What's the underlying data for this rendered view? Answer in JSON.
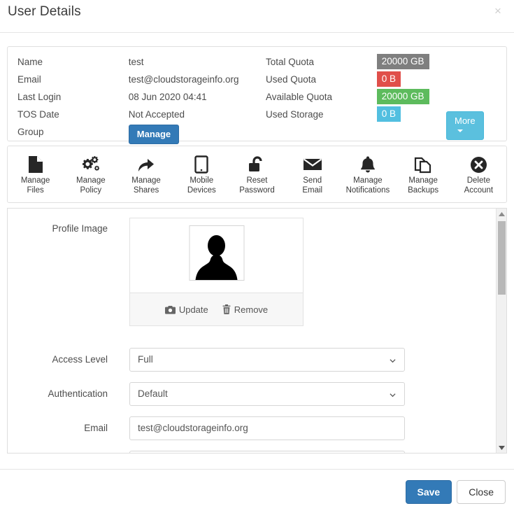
{
  "modal": {
    "title": "User Details",
    "close_icon": "close-icon",
    "close_label": "×"
  },
  "info": {
    "left_rows": [
      {
        "label": "Name",
        "value": "test"
      },
      {
        "label": "Email",
        "value": "test@cloudstorageinfo.org"
      },
      {
        "label": "Last Login",
        "value": "08 Jun 2020 04:41"
      },
      {
        "label": "TOS Date",
        "value": "Not Accepted"
      },
      {
        "label": "Group",
        "value": ""
      }
    ],
    "group_button": "Manage",
    "right_rows": [
      {
        "label": "Total Quota",
        "value": "20000 GB",
        "color": "gray"
      },
      {
        "label": "Used Quota",
        "value": "0 B",
        "color": "red"
      },
      {
        "label": "Available Quota",
        "value": "20000 GB",
        "color": "green"
      },
      {
        "label": "Used Storage",
        "value": "0 B",
        "color": "blue"
      }
    ],
    "more_button": "More",
    "colors": {
      "gray": "#7f7f7f",
      "red": "#e04f4a",
      "green": "#5dbb5d",
      "blue": "#52bfe0",
      "primary": "#337ab7"
    }
  },
  "toolbar": {
    "items": [
      {
        "icon": "file-icon",
        "line1": "Manage",
        "line2": "Files"
      },
      {
        "icon": "gears-icon",
        "line1": "Manage",
        "line2": "Policy"
      },
      {
        "icon": "share-arrow-icon",
        "line1": "Manage",
        "line2": "Shares"
      },
      {
        "icon": "tablet-icon",
        "line1": "Mobile",
        "line2": "Devices"
      },
      {
        "icon": "unlock-icon",
        "line1": "Reset",
        "line2": "Password"
      },
      {
        "icon": "envelope-icon",
        "line1": "Send",
        "line2": "Email"
      },
      {
        "icon": "bell-icon",
        "line1": "Manage",
        "line2": "Notifications"
      },
      {
        "icon": "copy-files-icon",
        "line1": "Manage",
        "line2": "Backups"
      },
      {
        "icon": "delete-circle-icon",
        "line1": "Delete",
        "line2": "Account"
      }
    ]
  },
  "form": {
    "profile_image_label": "Profile Image",
    "avatar_icon": "user-silhouette-icon",
    "update_label": "Update",
    "update_icon": "camera-icon",
    "remove_label": "Remove",
    "remove_icon": "trash-icon",
    "fields": [
      {
        "label": "Access Level",
        "value": "Full",
        "type": "select"
      },
      {
        "label": "Authentication",
        "value": "Default",
        "type": "select"
      },
      {
        "label": "Email",
        "value": "test@cloudstorageinfo.org",
        "type": "text"
      }
    ]
  },
  "scrollbar": {
    "up_icon": "caret-up-icon",
    "down_icon": "caret-down-icon",
    "thumb": "scroll-thumb"
  },
  "footer": {
    "save_label": "Save",
    "close_label": "Close"
  }
}
